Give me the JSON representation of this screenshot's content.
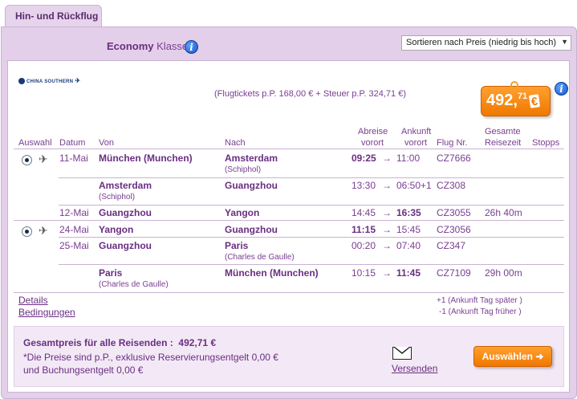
{
  "tab": {
    "label": "Hin- und Rückflug"
  },
  "header": {
    "class_label": "Economy",
    "class_suffix": "Klasse",
    "sort": {
      "selected": "Sortieren nach Preis (niedrig bis hoch)"
    }
  },
  "offer": {
    "airline": "CHINA SOUTHERN",
    "tax_line": "(Flugtickets p.P. 168,00 € + Steuer p.P. 324,71 €)",
    "price_main": "492,",
    "price_cents": "71",
    "price_currency": "€"
  },
  "columns": {
    "auswahl": "Auswahl",
    "datum": "Datum",
    "von": "Von",
    "nach": "Nach",
    "abreise_1": "Abreise",
    "abreise_2": "vorort",
    "ankunft_1": "Ankunft",
    "ankunft_2": "vorort",
    "flugnr": "Flug Nr.",
    "gesamt_1": "Gesamte",
    "gesamt_2": "Reisezeit",
    "stopps": "Stopps"
  },
  "segments": [
    {
      "date": "11-Mai",
      "from": "München (Munchen)",
      "from_sub": "",
      "to": "Amsterdam",
      "to_sub": "(Schiphol)",
      "dep": "09:25",
      "arr": "11:00",
      "flight": "CZ7666",
      "total": ""
    },
    {
      "date": "",
      "from": "Amsterdam",
      "from_sub": "(Schiphol)",
      "to": "Guangzhou",
      "to_sub": "",
      "dep": "13:30",
      "arr": "06:50+1",
      "flight": "CZ308",
      "total": ""
    },
    {
      "date": "12-Mai",
      "from": "Guangzhou",
      "from_sub": "",
      "to": "Yangon",
      "to_sub": "",
      "dep": "14:45",
      "arr": "16:35",
      "flight": "CZ3055",
      "total": "26h 40m"
    },
    {
      "date": "24-Mai",
      "from": "Yangon",
      "from_sub": "",
      "to": "Guangzhou",
      "to_sub": "",
      "dep": "11:15",
      "arr": "15:45",
      "flight": "CZ3056",
      "total": ""
    },
    {
      "date": "25-Mai",
      "from": "Guangzhou",
      "from_sub": "",
      "to": "Paris",
      "to_sub": "(Charles de Gaulle)",
      "dep": "00:20",
      "arr": "07:40",
      "flight": "CZ347",
      "total": ""
    },
    {
      "date": "",
      "from": "Paris",
      "from_sub": "(Charles de Gaulle)",
      "to": "München (Munchen)",
      "to_sub": "",
      "dep": "10:15",
      "arr": "11:45",
      "flight": "CZ7109",
      "total": "29h 00m"
    }
  ],
  "arrow": "→",
  "links": {
    "details": "Details",
    "conditions": "Bedingungen",
    "next_day": "+1 (Ankunft Tag später )",
    "prev_day": "-1 (Ankunft Tag früher )"
  },
  "total": {
    "label": "Gesamtpreis für alle Reisenden :",
    "value": "492,71 €",
    "note_1": "*Die Preise sind p.P., exklusive Reservierungsentgelt 0,00 €",
    "note_2": "und Buchungsentgelt 0,00 €",
    "send": "Versenden",
    "select": "Auswählen ➜"
  }
}
